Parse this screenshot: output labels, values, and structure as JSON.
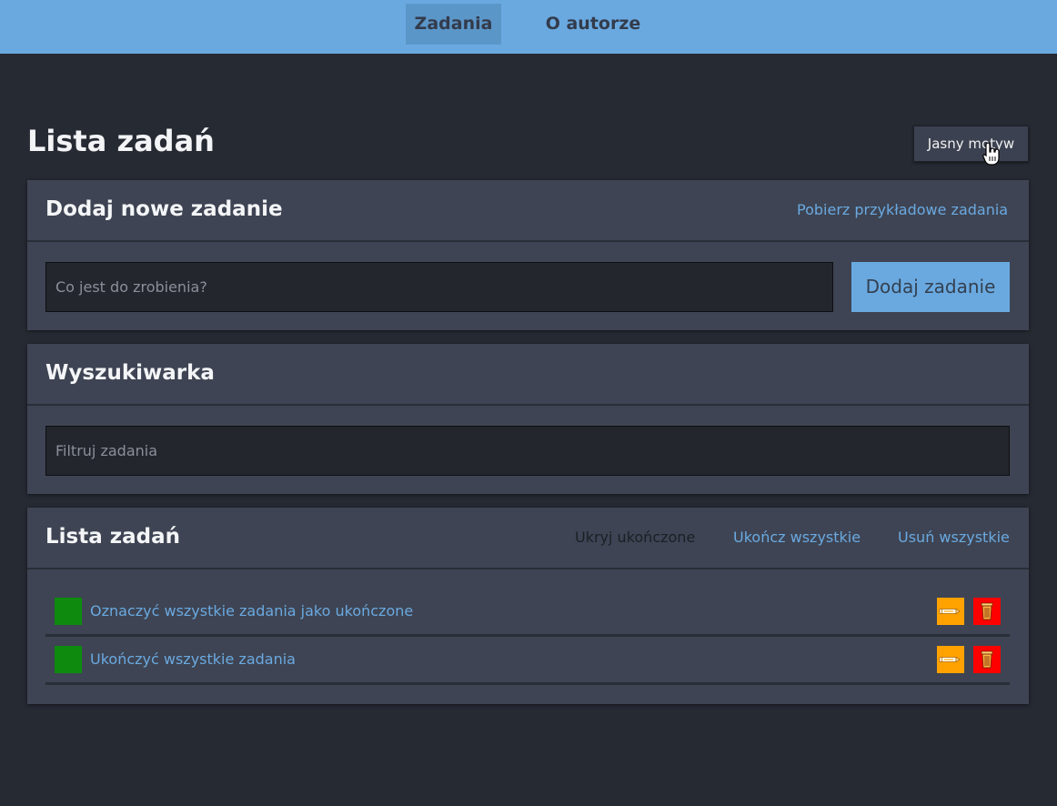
{
  "nav": {
    "items": [
      {
        "label": "Zadania",
        "active": true
      },
      {
        "label": "O autorze",
        "active": false
      }
    ]
  },
  "page": {
    "title": "Lista zadań",
    "theme_button": "Jasny motyw"
  },
  "add_card": {
    "title": "Dodaj nowe zadanie",
    "sample_link": "Pobierz przykładowe zadania",
    "input_placeholder": "Co jest do zrobienia?",
    "input_value": "",
    "add_button": "Dodaj zadanie"
  },
  "search_card": {
    "title": "Wyszukiwarka",
    "input_placeholder": "Filtruj zadania",
    "input_value": ""
  },
  "list_card": {
    "title": "Lista zadań",
    "actions": {
      "hide_completed": "Ukryj ukończone",
      "complete_all": "Ukończ wszystkie",
      "delete_all": "Usuń wszystkie"
    },
    "tasks": [
      {
        "text": "Oznaczyć wszystkie zadania jako ukończone"
      },
      {
        "text": "Ukończyć wszystkie zadania"
      }
    ]
  },
  "colors": {
    "nav_bar": "#6aa9e0",
    "background": "#262a33",
    "card": "#3e4453",
    "accent": "#6aa9e0",
    "check": "#0e8a0e",
    "edit": "#ffa200",
    "delete": "#ff0000"
  },
  "icons": {
    "edit": "pencil-icon",
    "delete": "trash-icon",
    "cursor": "hand-pointer-cursor"
  }
}
